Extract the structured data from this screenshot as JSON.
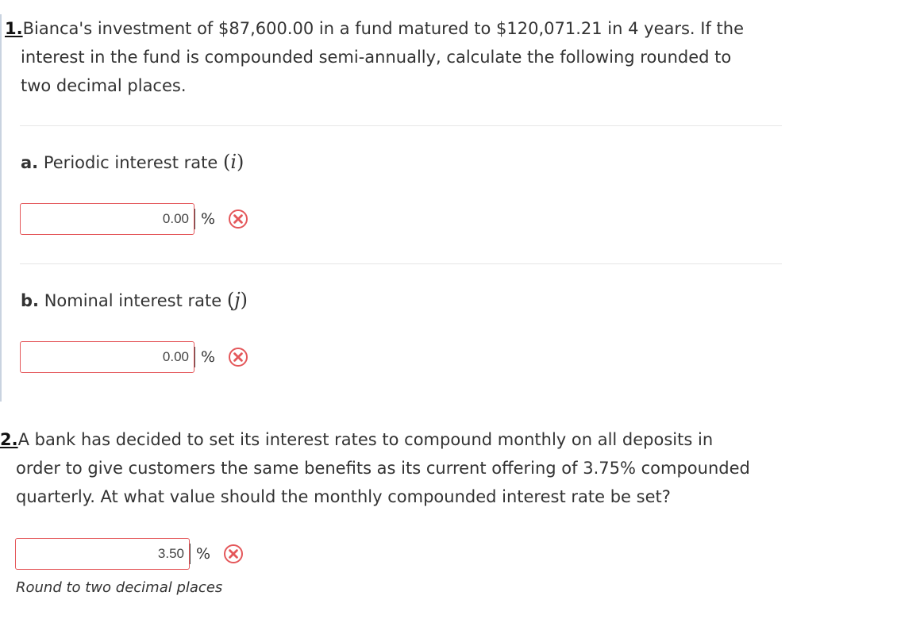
{
  "question1": {
    "number": "1.",
    "text_line1": "Bianca's investment of $87,600.00 in a fund matured to $120,071.21 in 4 years. If the",
    "text_line2": "interest in the fund is compounded semi-annually, calculate the following rounded to",
    "text_line3": "two decimal places.",
    "part_a": {
      "letter": "a.",
      "label": "Periodic interest rate",
      "variable": "i",
      "value": "0.00",
      "unit": "%"
    },
    "part_b": {
      "letter": "b.",
      "label": "Nominal interest rate",
      "variable": "j",
      "value": "0.00",
      "unit": "%"
    }
  },
  "question2": {
    "number": "2.",
    "text_line1": "A bank has decided to set its interest rates to compound monthly on all deposits in",
    "text_line2": "order to give customers the same benefits as its current offering of 3.75% compounded",
    "text_line3": "quarterly. At what value should the monthly compounded interest rate be set?",
    "value": "3.50",
    "unit": "%",
    "hint": "Round to two decimal places"
  },
  "colors": {
    "error_red": "#e4575a",
    "text": "#333333"
  },
  "icons": {
    "incorrect": "circle-x-icon"
  }
}
